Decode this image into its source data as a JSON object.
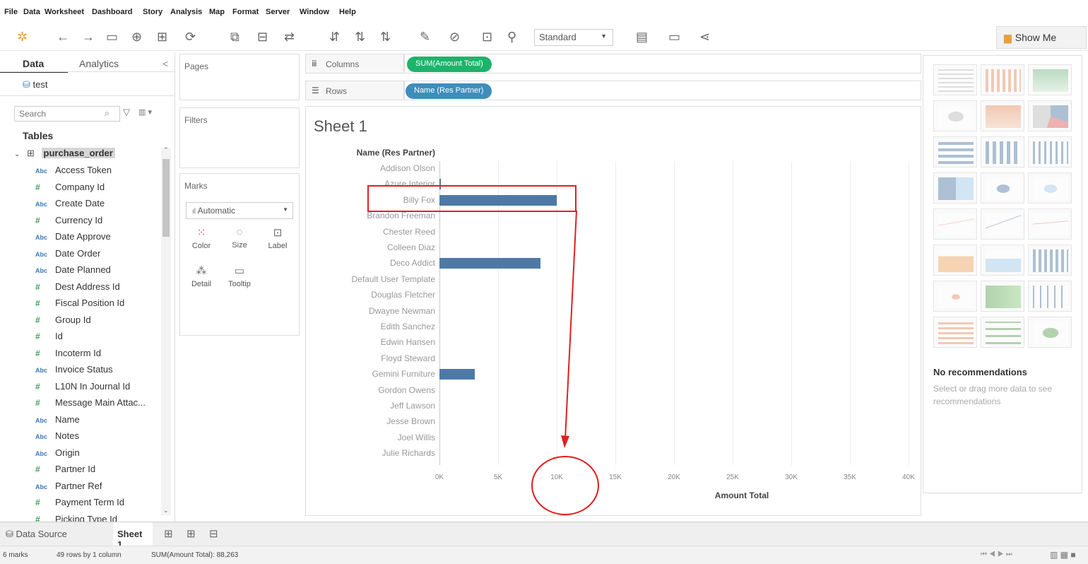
{
  "menu": [
    "File",
    "Data",
    "Worksheet",
    "Dashboard",
    "Story",
    "Analysis",
    "Map",
    "Format",
    "Server",
    "Window",
    "Help"
  ],
  "toolbar": {
    "fit_dropdown": "Standard",
    "show_me": "Show Me"
  },
  "left": {
    "tab_data": "Data",
    "tab_analytics": "Analytics",
    "collapse": "<",
    "datasource": "test",
    "search_placeholder": "Search",
    "tables_heading": "Tables",
    "table_name": "purchase_order",
    "fields": [
      {
        "type": "Abc",
        "name": "Access Token"
      },
      {
        "type": "#",
        "name": "Company Id"
      },
      {
        "type": "Abc",
        "name": "Create Date"
      },
      {
        "type": "#",
        "name": "Currency Id"
      },
      {
        "type": "Abc",
        "name": "Date Approve"
      },
      {
        "type": "Abc",
        "name": "Date Order"
      },
      {
        "type": "Abc",
        "name": "Date Planned"
      },
      {
        "type": "#",
        "name": "Dest Address Id"
      },
      {
        "type": "#",
        "name": "Fiscal Position Id"
      },
      {
        "type": "#",
        "name": "Group Id"
      },
      {
        "type": "#",
        "name": "Id"
      },
      {
        "type": "#",
        "name": "Incoterm Id"
      },
      {
        "type": "Abc",
        "name": "Invoice Status"
      },
      {
        "type": "#",
        "name": "L10N In Journal Id"
      },
      {
        "type": "#",
        "name": "Message Main Attac..."
      },
      {
        "type": "Abc",
        "name": "Name"
      },
      {
        "type": "Abc",
        "name": "Notes"
      },
      {
        "type": "Abc",
        "name": "Origin"
      },
      {
        "type": "#",
        "name": "Partner Id"
      },
      {
        "type": "Abc",
        "name": "Partner Ref"
      },
      {
        "type": "#",
        "name": "Payment Term Id"
      },
      {
        "type": "#",
        "name": "Picking Type Id"
      }
    ]
  },
  "cards": {
    "pages": "Pages",
    "filters": "Filters",
    "marks": "Marks",
    "mark_type": "Automatic",
    "color": "Color",
    "size": "Size",
    "label": "Label",
    "detail": "Detail",
    "tooltip": "Tooltip"
  },
  "shelves": {
    "columns_label": "Columns",
    "columns_pill": "SUM(Amount Total)",
    "rows_label": "Rows",
    "rows_pill": "Name (Res Partner)"
  },
  "sheet": {
    "title": "Sheet 1",
    "row_header": "Name (Res Partner)",
    "x_axis_title": "Amount Total"
  },
  "chart_data": {
    "type": "bar",
    "orientation": "horizontal",
    "title": "Sheet 1",
    "ylabel": "Name (Res Partner)",
    "xlabel": "Amount Total",
    "categories": [
      "Addison Olson",
      "Azure Interior",
      "Billy Fox",
      "Brandon Freeman",
      "Chester Reed",
      "Colleen Diaz",
      "Deco Addict",
      "Default User Template",
      "Douglas Fletcher",
      "Dwayne Newman",
      "Edith Sanchez",
      "Edwin Hansen",
      "Floyd Steward",
      "Gemini Furniture",
      "Gordon Owens",
      "Jeff Lawson",
      "Jesse Brown",
      "Joel Willis",
      "Julie Richards"
    ],
    "values": [
      0,
      150,
      10000,
      0,
      0,
      0,
      8600,
      0,
      0,
      0,
      0,
      0,
      0,
      3000,
      0,
      0,
      0,
      0,
      0
    ],
    "xticks": [
      "0K",
      "5K",
      "10K",
      "15K",
      "20K",
      "25K",
      "30K",
      "35K",
      "40K"
    ],
    "xlim": [
      0,
      40000
    ],
    "grid": true
  },
  "showme": {
    "no_rec_title": "No recommendations",
    "no_rec_text": "Select or drag more data to see recommendations"
  },
  "bottom": {
    "data_source": "Data Source",
    "sheet_tab": "Sheet 1"
  },
  "status": {
    "marks": "6 marks",
    "rows": "49 rows by 1 column",
    "sum": "SUM(Amount Total): 88,263"
  },
  "colors": {
    "bar": "#4e79a7",
    "columns_pill": "#1db36b",
    "rows_pill": "#3d8ebc",
    "annotation": "#e02020"
  }
}
